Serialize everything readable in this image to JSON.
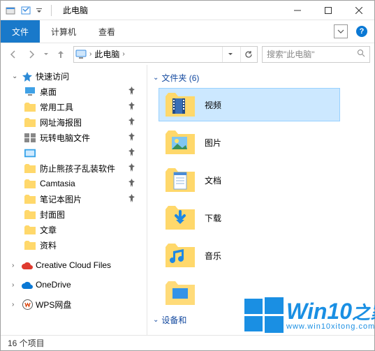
{
  "window": {
    "title": "此电脑",
    "controls": {
      "min": "—",
      "max": "☐",
      "close": "✕"
    }
  },
  "ribbon": {
    "file": "文件",
    "computer": "计算机",
    "view": "查看"
  },
  "nav": {
    "crumb_root": "此电脑",
    "search_placeholder": "搜索\"此电脑\""
  },
  "sidebar": {
    "quick_access": "快速访问",
    "items": [
      {
        "label": "桌面",
        "icon": "desktop",
        "pinned": true
      },
      {
        "label": "常用工具",
        "icon": "folder",
        "pinned": true
      },
      {
        "label": "网址海报图",
        "icon": "folder",
        "pinned": true
      },
      {
        "label": "玩转电脑文件",
        "icon": "tiles",
        "pinned": true
      },
      {
        "label": "",
        "icon": "blue-square",
        "pinned": true
      },
      {
        "label": "防止熊孩子乱装软件",
        "icon": "folder",
        "pinned": true
      },
      {
        "label": "Camtasia",
        "icon": "folder",
        "pinned": true
      },
      {
        "label": "笔记本图片",
        "icon": "folder",
        "pinned": true
      },
      {
        "label": "封面图",
        "icon": "folder",
        "pinned": false
      },
      {
        "label": "文章",
        "icon": "folder",
        "pinned": false
      },
      {
        "label": "资料",
        "icon": "folder",
        "pinned": false
      }
    ],
    "creative_cloud": "Creative Cloud Files",
    "onedrive": "OneDrive",
    "wps": "WPS网盘"
  },
  "content": {
    "group_folders": "文件夹 (6)",
    "tiles": [
      {
        "label": "视频",
        "selected": true,
        "icon": "video"
      },
      {
        "label": "图片",
        "selected": false,
        "icon": "pictures"
      },
      {
        "label": "文档",
        "selected": false,
        "icon": "documents"
      },
      {
        "label": "下载",
        "selected": false,
        "icon": "downloads"
      },
      {
        "label": "音乐",
        "selected": false,
        "icon": "music"
      }
    ],
    "group_devices": "设备和"
  },
  "status": {
    "count": "16 个项目"
  },
  "watermark": {
    "brand": "Win10",
    "suffix": "之家",
    "url": "www.win10xitong.com"
  }
}
